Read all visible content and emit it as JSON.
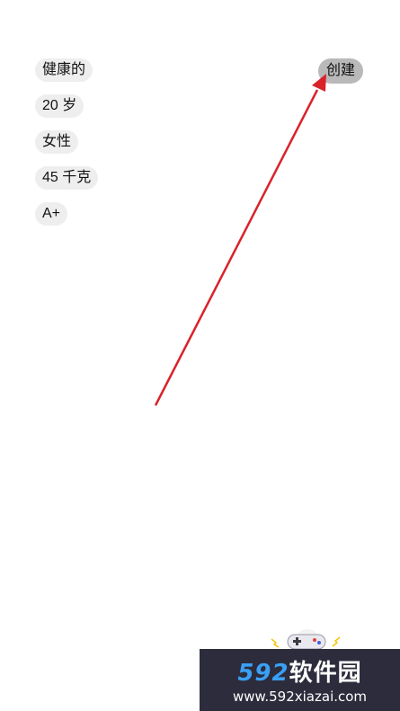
{
  "attributes": [
    {
      "label": "健康的"
    },
    {
      "label": "20 岁"
    },
    {
      "label": "女性"
    },
    {
      "label": "45 千克"
    },
    {
      "label": "A+"
    }
  ],
  "create_button": {
    "label": "创建"
  },
  "annotation": {
    "arrow_color": "#d9222a"
  },
  "colors": {
    "chip_bg": "#eeeeee",
    "create_bg": "#b9b9b9",
    "watermark_bg": "#2c2c3c",
    "watermark_accent": "#3aa0f5"
  },
  "watermark": {
    "brand_number": "592",
    "brand_text": "软件园",
    "url": "www.592xiazai.com",
    "icon": "gamepad-icon"
  }
}
